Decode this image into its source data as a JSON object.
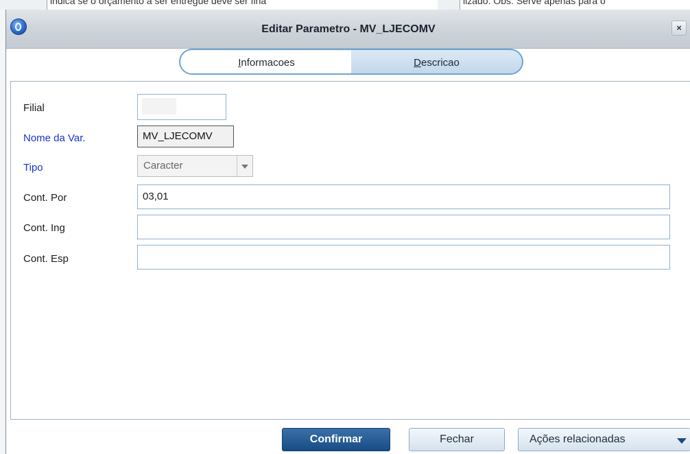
{
  "background_window": {
    "cell1_text": "indica se o orçamento a ser entregue deve ser fina",
    "cell2_text": "lizado. Obs: Serve apenas para o"
  },
  "dialog": {
    "title": "Editar Parametro - MV_LJECOMV",
    "close_label": "×"
  },
  "tabs": [
    {
      "label": "Informacoes",
      "accesskey": "I",
      "rest": "nformacoes",
      "active": true
    },
    {
      "label": "Descricao",
      "accesskey": "D",
      "rest": "escricao",
      "active": false
    }
  ],
  "form": {
    "filial": {
      "label": "Filial",
      "value": ""
    },
    "nome_var": {
      "label": "Nome da Var.",
      "value": "MV_LJECOMV"
    },
    "tipo": {
      "label": "Tipo",
      "value": "Caracter"
    },
    "cont_por": {
      "label": "Cont. Por",
      "value": "03,01"
    },
    "cont_ing": {
      "label": "Cont. Ing",
      "value": ""
    },
    "cont_esp": {
      "label": "Cont. Esp",
      "value": ""
    }
  },
  "buttons": {
    "confirm": "Confirmar",
    "close": "Fechar",
    "related_actions": "Ações relacionadas"
  },
  "icons": {
    "app": "app-logo-icon",
    "close": "close-icon",
    "dropdown": "chevron-down-icon"
  },
  "colors": {
    "required_label": "#1a33c8",
    "primary_button": "#174c85",
    "tab_border": "#6aa5d6"
  }
}
